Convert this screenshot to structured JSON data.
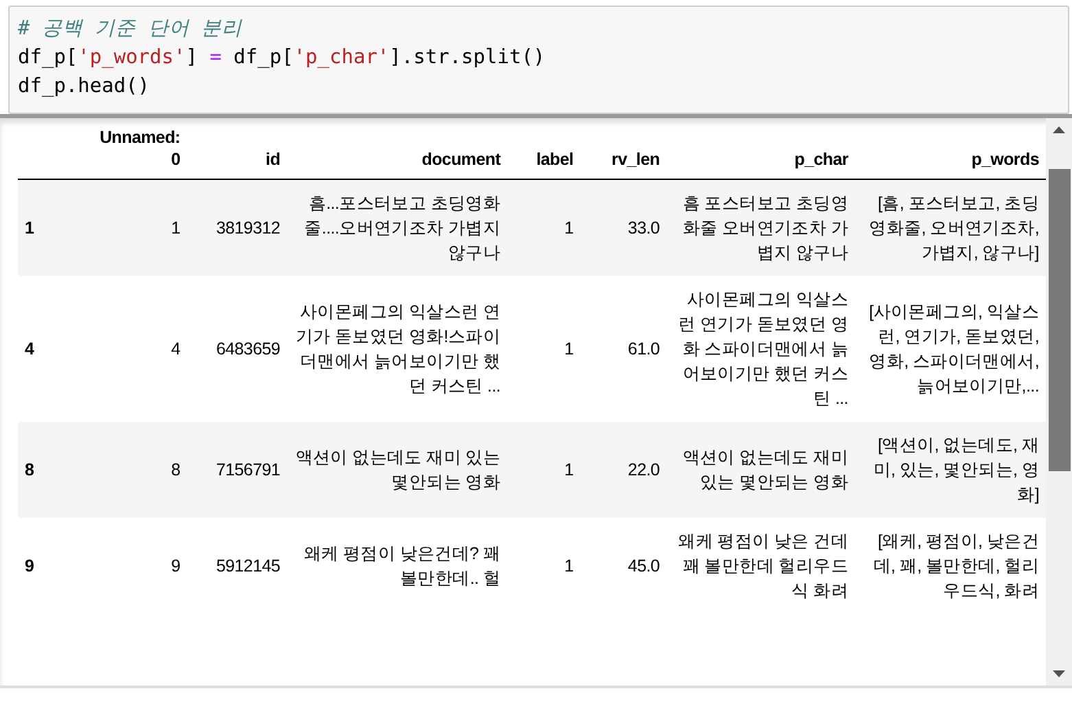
{
  "code_cell": {
    "lines": [
      [
        {
          "kind": "comment",
          "text": "# 공백 기준 단어 분리"
        }
      ],
      [
        {
          "kind": "plain",
          "text": "df_p["
        },
        {
          "kind": "string",
          "text": "'p_words'"
        },
        {
          "kind": "plain",
          "text": "] "
        },
        {
          "kind": "operator",
          "text": "="
        },
        {
          "kind": "plain",
          "text": " df_p["
        },
        {
          "kind": "string",
          "text": "'p_char'"
        },
        {
          "kind": "plain",
          "text": "].str.split()"
        }
      ],
      [
        {
          "kind": "plain",
          "text": "df_p.head()"
        }
      ]
    ]
  },
  "table": {
    "columns": [
      "",
      "Unnamed: 0",
      "id",
      "document",
      "label",
      "rv_len",
      "p_char",
      "p_words"
    ],
    "rows": [
      {
        "cells": [
          "1",
          "1",
          "3819312",
          "흠...포스터보고 초딩영화줄....오버연기조차 가볍지 않구나",
          "1",
          "33.0",
          "흠 포스터보고 초딩영화줄 오버연기조차 가볍지 않구나",
          "[흠, 포스터보고, 초딩영화줄, 오버연기조차, 가볍지, 않구나]"
        ]
      },
      {
        "cells": [
          "4",
          "4",
          "6483659",
          "사이몬페그의 익살스런 연기가 돋보였던 영화!스파이더맨에서 늙어보이기만 했던 커스틴 ...",
          "1",
          "61.0",
          "사이몬페그의 익살스런 연기가 돋보였던 영화 스파이더맨에서 늙어보이기만 했던 커스틴 ...",
          "[사이몬페그의, 익살스런, 연기가, 돋보였던, 영화, 스파이더맨에서, 늙어보이기만,..."
        ]
      },
      {
        "cells": [
          "8",
          "8",
          "7156791",
          "액션이 없는데도 재미 있는 몇안되는 영화",
          "1",
          "22.0",
          "액션이 없는데도 재미 있는 몇안되는 영화",
          "[액션이, 없는데도, 재미, 있는, 몇안되는, 영화]"
        ]
      },
      {
        "cells": [
          "9",
          "9",
          "5912145",
          "왜케 평점이 낮은건데? 꽤 볼만한데.. 헐",
          "1",
          "45.0",
          "왜케 평점이 낮은 건데 꽤 볼만한데 헐리우드식 화려",
          "[왜케, 평점이, 낮은건데, 꽤, 볼만한데, 헐리우드식, 화려"
        ]
      }
    ]
  }
}
